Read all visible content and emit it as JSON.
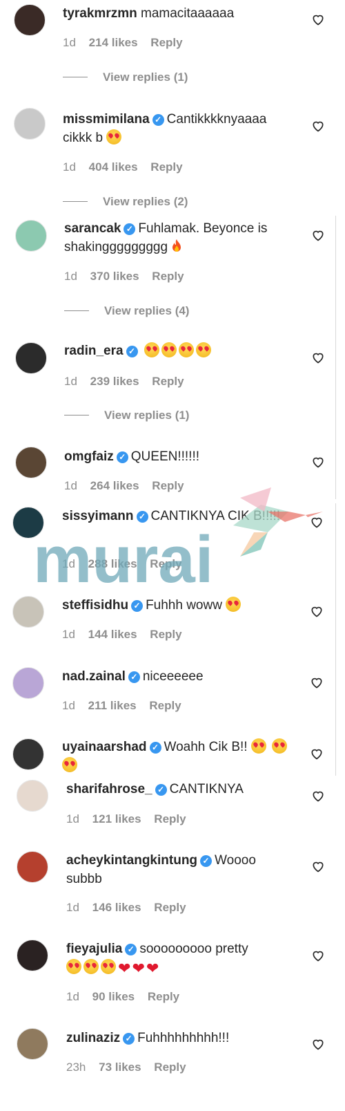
{
  "comments": [
    {
      "username": "tyrakmrzmn",
      "verified": false,
      "text": "mamacitaaaaaa",
      "emojis": [],
      "time": "1d",
      "likes": "214 likes",
      "reply": "Reply",
      "view_replies": "View replies (1)",
      "avatar_color": "#3a2a26"
    },
    {
      "username": "missmimilana",
      "verified": true,
      "text": "Cantikkkknyaaaa cikkk b",
      "emojis": [
        "heart-eyes"
      ],
      "time": "1d",
      "likes": "404 likes",
      "reply": "Reply",
      "view_replies": "View replies (2)",
      "avatar_color": "#c9c9c9"
    },
    {
      "username": "sarancak",
      "verified": true,
      "text": "Fuhlamak. Beyonce is shakinggggggggg",
      "emojis": [
        "fire"
      ],
      "time": "1d",
      "likes": "370 likes",
      "reply": "Reply",
      "view_replies": "View replies (4)",
      "avatar_color": "#8cc9b0"
    },
    {
      "username": "radin_era",
      "verified": true,
      "text": "",
      "emojis": [
        "heart-eyes",
        "heart-eyes",
        "heart-eyes",
        "heart-eyes"
      ],
      "time": "1d",
      "likes": "239 likes",
      "reply": "Reply",
      "view_replies": "View replies (1)",
      "avatar_color": "#2b2b2b"
    },
    {
      "username": "omgfaiz",
      "verified": true,
      "text": "QUEEN!!!!!!",
      "emojis": [],
      "time": "1d",
      "likes": "264 likes",
      "reply": "Reply",
      "view_replies": "",
      "avatar_color": "#5a4634"
    },
    {
      "username": "sissyimann",
      "verified": true,
      "text": "CANTIKNYA CIK B!!!!!",
      "emojis": [],
      "time": "1d",
      "likes": "288 likes",
      "reply": "Reply",
      "view_replies": "",
      "avatar_color": "#1c3b45"
    },
    {
      "username": "steffisidhu",
      "verified": true,
      "text": "Fuhhh woww",
      "emojis": [
        "heart-eyes"
      ],
      "time": "1d",
      "likes": "144 likes",
      "reply": "Reply",
      "view_replies": "",
      "avatar_color": "#c8c3b8"
    },
    {
      "username": "nad.zainal",
      "verified": true,
      "text": "niceeeeee",
      "emojis": [],
      "time": "1d",
      "likes": "211 likes",
      "reply": "Reply",
      "view_replies": "",
      "avatar_color": "#b9a6d6"
    },
    {
      "username": "uyainaarshad",
      "verified": true,
      "text": "Woahh Cik B!!",
      "emojis": [
        "heart-eyes",
        "heart-eyes",
        "heart-eyes"
      ],
      "time": "",
      "likes": "",
      "reply": "",
      "view_replies": "",
      "avatar_color": "#333333"
    },
    {
      "username": "sharifahrose_",
      "verified": true,
      "text": "CANTIKNYA",
      "emojis": [],
      "time": "1d",
      "likes": "121 likes",
      "reply": "Reply",
      "view_replies": "",
      "avatar_color": "#e6d9cf"
    },
    {
      "username": "acheykintangkintung",
      "verified": true,
      "text": "Woooo subbb",
      "emojis": [],
      "time": "1d",
      "likes": "146 likes",
      "reply": "Reply",
      "view_replies": "",
      "avatar_color": "#b5402e"
    },
    {
      "username": "fieyajulia",
      "verified": true,
      "text": "sooooooooo pretty",
      "emojis": [
        "heart-eyes",
        "heart-eyes",
        "heart-eyes",
        "red-heart",
        "red-heart",
        "red-heart"
      ],
      "time": "1d",
      "likes": "90 likes",
      "reply": "Reply",
      "view_replies": "",
      "avatar_color": "#2a2222"
    },
    {
      "username": "zulinaziz",
      "verified": true,
      "text": "Fuhhhhhhhhh!!!",
      "emojis": [],
      "time": "23h",
      "likes": "73 likes",
      "reply": "Reply",
      "view_replies": "",
      "avatar_color": "#8f7a5e"
    }
  ],
  "watermark": {
    "text": "murai",
    "color": "#6fa8b8",
    "accent": "#e8746a"
  }
}
